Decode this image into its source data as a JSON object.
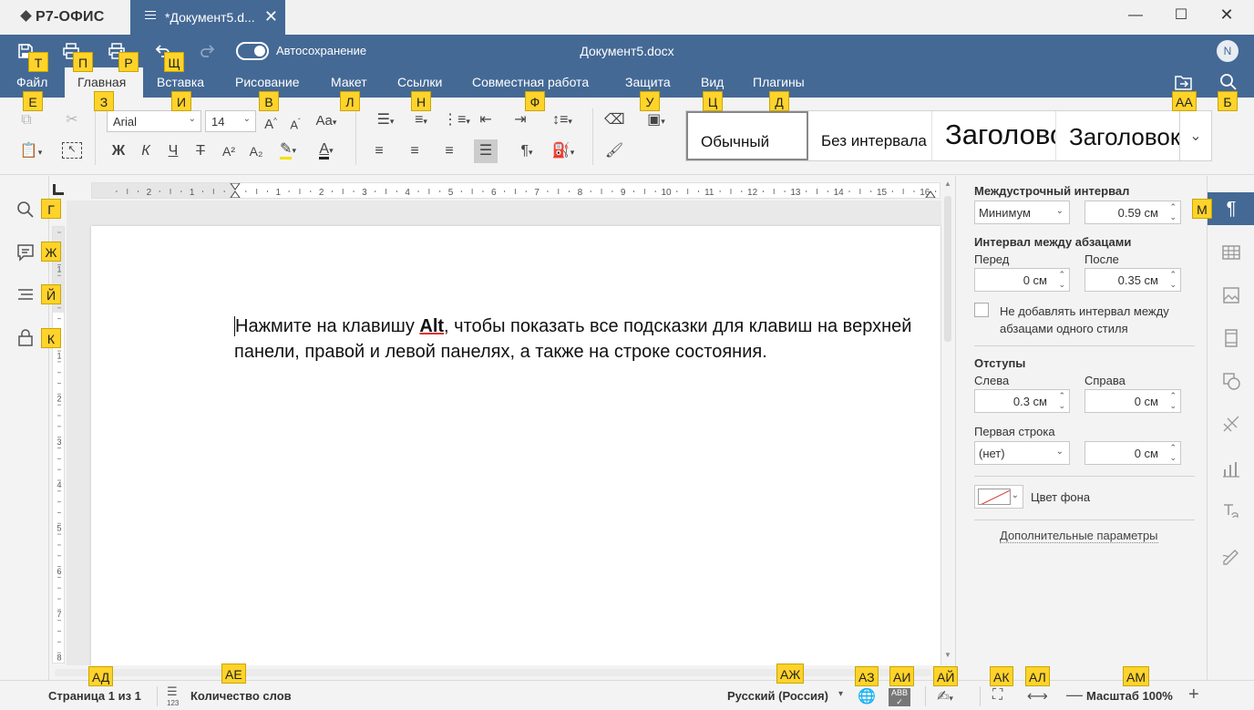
{
  "app": {
    "name": "Р7-ОФИС",
    "tab_title": "*Документ5.d...",
    "doc_title": "Документ5.docx",
    "autosave_label": "Автосохранение",
    "user_initial": "N"
  },
  "menu_tabs": [
    "Файл",
    "Главная",
    "Вставка",
    "Рисование",
    "Макет",
    "Ссылки",
    "Совместная работа",
    "Защита",
    "Вид",
    "Плагины"
  ],
  "active_tab": "Главная",
  "toolbar": {
    "font_name": "Arial",
    "font_size": "14",
    "bold": "Ж",
    "italic": "К",
    "underline": "Ч",
    "strike": "Т",
    "superscript": "A²",
    "subscript": "A₂",
    "styles": [
      "Обычный",
      "Без интервала",
      "Заголовок 1",
      "Заголовок 2"
    ]
  },
  "hints": {
    "save": "Т",
    "print": "П",
    "quick_print": "Р",
    "undo": "Щ",
    "file": "Е",
    "home": "З",
    "insert": "И",
    "draw": "В",
    "layout": "Л",
    "refs": "Н",
    "collab": "Ф",
    "protect": "У",
    "view": "Ц",
    "plugins": "Д",
    "open_location": "АА",
    "search_top": "Б",
    "find": "Г",
    "comments": "Ж",
    "navigation": "Й",
    "lock": "К",
    "paragraph": "М",
    "page_num": "АД",
    "word_count": "АЕ",
    "language": "АЖ",
    "doc_lang": "АЗ",
    "spellcheck": "АИ",
    "track": "АЙ",
    "fit_page": "АК",
    "fit_width": "АЛ",
    "zoom": "АМ"
  },
  "document": {
    "text_before": "Нажмите на клавишу ",
    "key": "Alt",
    "text_after": ", чтобы показать все подсказки для клавиш на верхней панели, правой и левой панелях, а также на строке состояния."
  },
  "ruler": {
    "left_marks": [
      "2",
      "1"
    ],
    "right_marks": [
      "1",
      "2",
      "3",
      "4",
      "5",
      "6",
      "7",
      "8",
      "9",
      "10",
      "11",
      "12",
      "13",
      "14",
      "15",
      "16"
    ],
    "v_marks": [
      "1",
      "1",
      "2",
      "3",
      "4",
      "5",
      "6",
      "7",
      "8"
    ]
  },
  "paragraph_panel": {
    "line_spacing_label": "Междустрочный интервал",
    "line_spacing_mode": "Минимум",
    "line_spacing_value": "0.59 см",
    "para_spacing_label": "Интервал между абзацами",
    "before_label": "Перед",
    "before_value": "0 см",
    "after_label": "После",
    "after_value": "0.35 см",
    "no_spacing_label": "Не добавлять интервал между абзацами одного стиля",
    "indents_label": "Отступы",
    "left_label": "Слева",
    "left_value": "0.3 см",
    "right_label": "Справа",
    "right_value": "0 см",
    "first_line_label": "Первая строка",
    "first_line_mode": "(нет)",
    "first_line_value": "0 см",
    "bg_color_label": "Цвет фона",
    "more_params": "Дополнительные параметры"
  },
  "statusbar": {
    "page_info": "Страница 1 из 1",
    "word_count": "Количество слов",
    "language": "Русский (Россия)",
    "zoom_label": "Масштаб 100%"
  }
}
